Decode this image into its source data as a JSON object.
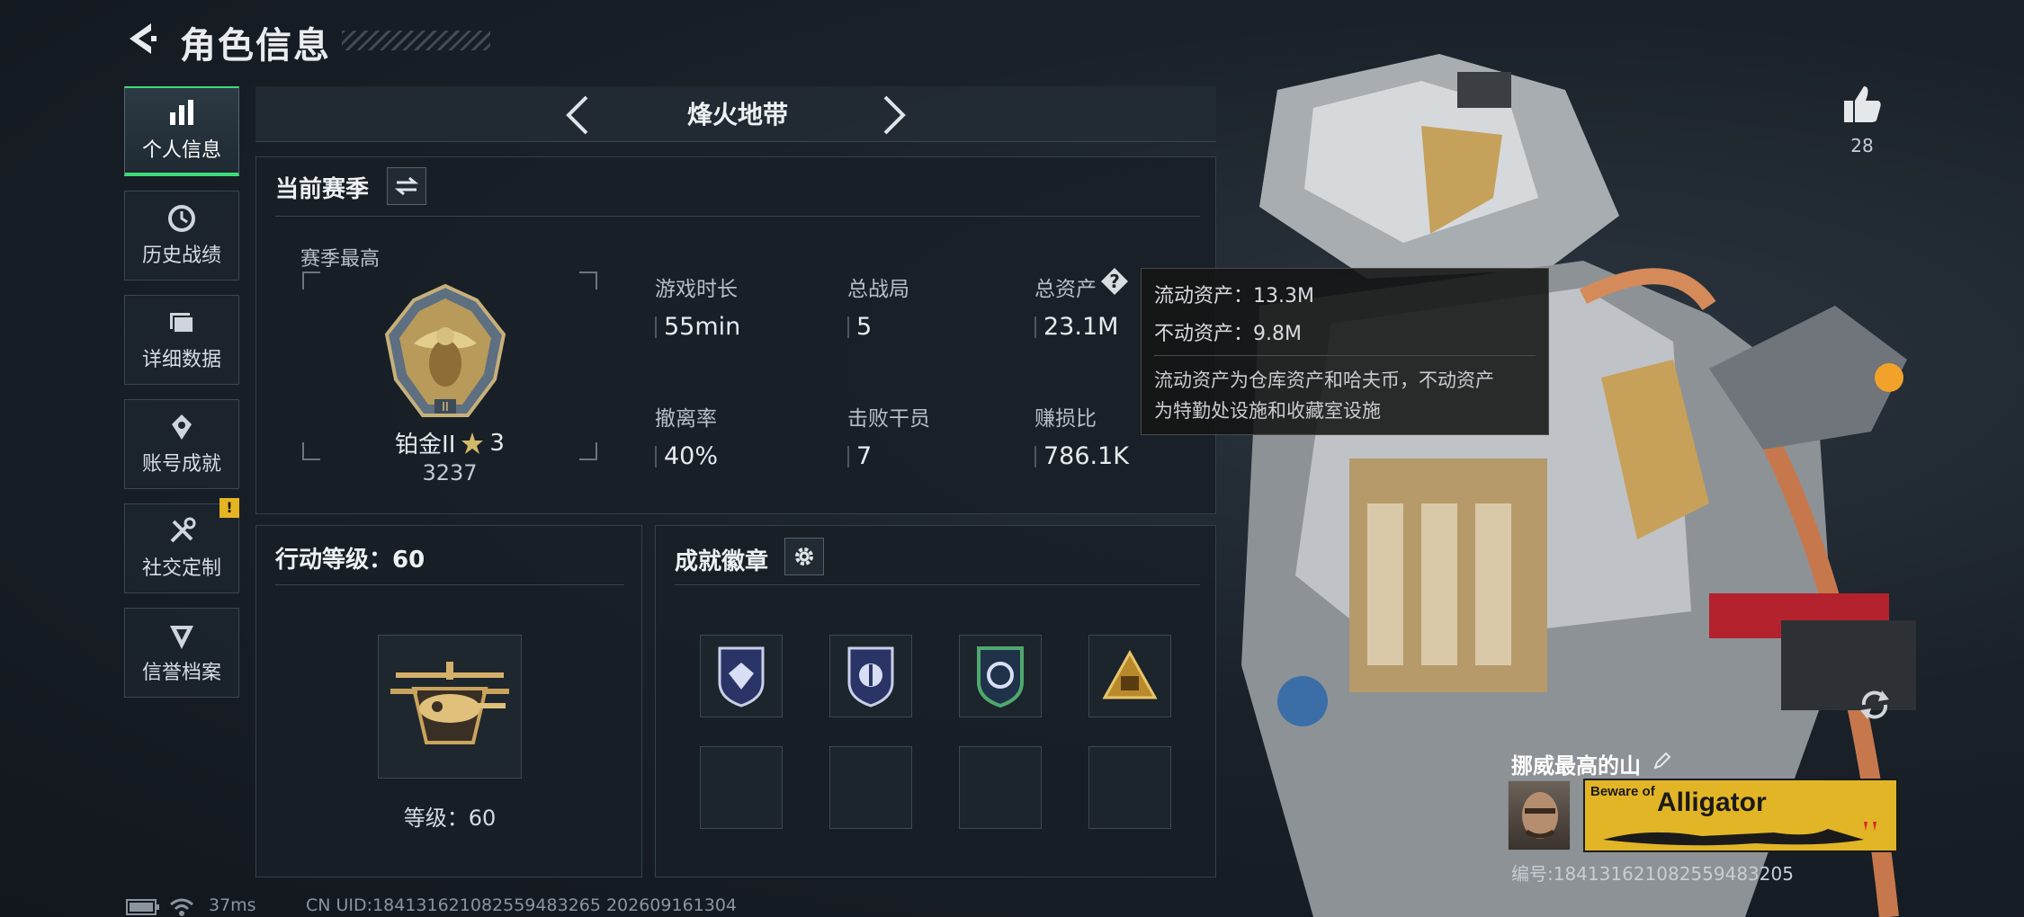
{
  "header": {
    "title": "角色信息"
  },
  "sidebar": {
    "items": [
      {
        "label": "个人信息",
        "icon": "bar-chart-icon",
        "active": true
      },
      {
        "label": "历史战绩",
        "icon": "history-icon",
        "active": false
      },
      {
        "label": "详细数据",
        "icon": "folder-icon",
        "active": false
      },
      {
        "label": "账号成就",
        "icon": "achievement-icon",
        "active": false
      },
      {
        "label": "社交定制",
        "icon": "tools-icon",
        "active": false,
        "badge": "!"
      },
      {
        "label": "信誉档案",
        "icon": "shield-icon",
        "active": false
      }
    ]
  },
  "mode": {
    "title": "烽火地带"
  },
  "season": {
    "title": "当前赛季",
    "best_label": "赛季最高",
    "rank_name": "铂金II",
    "rank_stars": "3",
    "rank_score": "3237",
    "stats": [
      {
        "label": "游戏时长",
        "value": "55min"
      },
      {
        "label": "总战局",
        "value": "5"
      },
      {
        "label": "总资产",
        "value": "23.1M"
      },
      {
        "label": "撤离率",
        "value": "40%"
      },
      {
        "label": "击败干员",
        "value": "7"
      },
      {
        "label": "赚损比",
        "value": "786.1K"
      }
    ]
  },
  "tooltip": {
    "line1": "流动资产：13.3M",
    "line2": "不动资产：9.8M",
    "note1": "流动资产为仓库资产和哈夫币，不动资产",
    "note2": "为特勤处设施和收藏室设施"
  },
  "action_level": {
    "title": "行动等级：60",
    "level_text": "等级：60"
  },
  "achievements": {
    "title": "成就徽章"
  },
  "profile": {
    "likes": "28",
    "player_name": "挪威最高的山",
    "player_id": "编号:1841316210825594832​05",
    "banner_small": "Beware of",
    "banner_big": "Alligator"
  },
  "footer": {
    "ping": "37ms",
    "uid": "CN UID:184131621082559483265 202609161304"
  },
  "colors": {
    "accent_green": "#3ddc7a",
    "badge_yellow": "#e5b422",
    "banner_yellow": "#e2b526"
  }
}
